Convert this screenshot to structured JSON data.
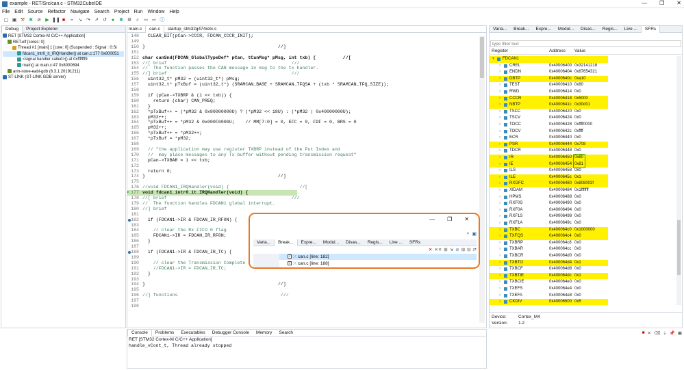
{
  "window": {
    "title": "example - RET/Src/can.c - STM32CubeIDE",
    "min": "—",
    "max": "❐",
    "close": "✕"
  },
  "menu": [
    "File",
    "Edit",
    "Source",
    "Refactor",
    "Navigate",
    "Search",
    "Project",
    "Run",
    "Window",
    "Help"
  ],
  "debug_panel": {
    "tabs": [
      "Debug",
      "Project Explorer"
    ],
    "tree": [
      {
        "t": "RET [STM32 Cortex-M C/C++ Application]",
        "indent": 0
      },
      {
        "t": "RET.elf [cores: 0]",
        "indent": 1
      },
      {
        "t": "Thread #1 [main] 1 [core: 0] (Suspended : Signal : 0:Si",
        "indent": 2
      },
      {
        "t": "fdcan1_intr0_it_IRQHandler() at can.c:177 0x800051",
        "indent": 3,
        "sel": true
      },
      {
        "t": "<signal handler called>() at 0xfffffff9",
        "indent": 3
      },
      {
        "t": "main() at main.c:47 0x8000694",
        "indent": 3
      },
      {
        "t": "arm-none-eabi-gdb (8.3.1.20191211)",
        "indent": 1
      },
      {
        "t": "ST-LINK (ST-LINK GDB server)",
        "indent": 0
      }
    ]
  },
  "editor": {
    "tabs": [
      "main.c",
      "can.c",
      "startup_stm32g474retx.s"
    ],
    "lines": [
      {
        "n": "148",
        "t": "  CLEAR_BIT(pCan->CCCR, FDCAN_CCCR_INIT);"
      },
      {
        "n": "149",
        "t": ""
      },
      {
        "n": "150",
        "t": "}                                                 //]"
      },
      {
        "n": "151",
        "t": ""
      },
      {
        "n": "152",
        "t": "char canSnd(FDCAN_GlobalTypeDef* pCan, tCanMsg* pMsg, int txb) {          //["
      },
      {
        "n": "153",
        "t": "//[ brief                                              ///"
      },
      {
        "n": "154",
        "t": "//  The function passes the CAN message in msg to the tx handler."
      },
      {
        "n": "155",
        "t": "//] brief                                              ///"
      },
      {
        "n": "156",
        "t": "  uint32_t* pM32 = (uint32_t*) pMsg;"
      },
      {
        "n": "157",
        "t": "  uint32_t* pTxBuf = (uint32_t*) (SRAMCAN_BASE + SRAMCAN_TFQSA + (txb * SRAMCAN_TFQ_SIZE));"
      },
      {
        "n": "158",
        "t": ""
      },
      {
        "n": "159",
        "t": "  if (pCan->TXBRP & (1 << txb)) {"
      },
      {
        "n": "160",
        "t": "    return (char) CAN_PREQ;"
      },
      {
        "n": "161",
        "t": "  }"
      },
      {
        "n": "162",
        "t": "  *pTxBuf++ = (*pM32 & 0x80000000U) ? (*pM32 << 18U) : (*pM32 | 0x40000000U);"
      },
      {
        "n": "163",
        "t": "  pM32++;"
      },
      {
        "n": "164",
        "t": "  *pTxBuf++ = *pM32 & 0x000F0000U;    // MM[7:0] = 0, EFC = 0, FDF = 0, BRS = 0"
      },
      {
        "n": "165",
        "t": "  pM32++;"
      },
      {
        "n": "166",
        "t": "  *pTxBuf++ = *pM32++;"
      },
      {
        "n": "167",
        "t": "  *pTxBuf = *pM32;"
      },
      {
        "n": "168",
        "t": ""
      },
      {
        "n": "169",
        "t": "  // \"the application may use register TXBRP instead of the Put Index and"
      },
      {
        "n": "170",
        "t": "  //  may place messages to any Tx buffer without pending transmission request\""
      },
      {
        "n": "171",
        "t": "  pCan->TXBAR = 1 << txb;"
      },
      {
        "n": "172",
        "t": ""
      },
      {
        "n": "173",
        "t": "  return 0;"
      },
      {
        "n": "174",
        "t": "}                                                 //]"
      },
      {
        "n": "175",
        "t": ""
      },
      {
        "n": "176",
        "t": "//void FDCAN1_IRQHandler(void) {                          //["
      },
      {
        "n": "177",
        "t": "void fdcan1_intr0_it_IRQHandler(void) {",
        "hl": true
      },
      {
        "n": "178",
        "t": "//[ brief                                              ///"
      },
      {
        "n": "179",
        "t": "//  The function handles FDCAN1 global interrupt."
      },
      {
        "n": "180",
        "t": "//] brief"
      },
      {
        "n": "181",
        "t": ""
      },
      {
        "n": "182",
        "t": "  if (FDCAN1->IR & FDCAN_IR_RF0N) {"
      },
      {
        "n": "183",
        "t": ""
      },
      {
        "n": "184",
        "t": "    // clear the Rx FIFO 0 flag"
      },
      {
        "n": "185",
        "t": "    FDCAN1->IR = FDCAN_IR_RF0N;"
      },
      {
        "n": "186",
        "t": "  }"
      },
      {
        "n": "187",
        "t": ""
      },
      {
        "n": "188",
        "t": "  if (FDCAN1->IR & FDCAN_IR_TC) {"
      },
      {
        "n": "189",
        "t": ""
      },
      {
        "n": "190",
        "t": "    // clear the Transmission Complete flag */"
      },
      {
        "n": "191",
        "t": "    //FDCAN1->IR = FDCAN_IR_TC;"
      },
      {
        "n": "192",
        "t": "  }"
      },
      {
        "n": "193",
        "t": ""
      },
      {
        "n": "194",
        "t": "}                                                 //]"
      },
      {
        "n": "195",
        "t": ""
      },
      {
        "n": "196",
        "t": "//] functions                                      ///"
      },
      {
        "n": "197",
        "t": ""
      },
      {
        "n": "198",
        "t": ""
      }
    ]
  },
  "breakpoints_popup": {
    "tabs": [
      "Varia...",
      "Break...",
      "Expre...",
      "Modul...",
      "Disas...",
      "Regis...",
      "Live ...",
      "SFRs"
    ],
    "items": [
      "can.c [line: 182]",
      "can.c [line: 188]"
    ]
  },
  "console": {
    "tabs": [
      "Console",
      "Problems",
      "Executables",
      "Debugger Console",
      "Memory",
      "Search"
    ],
    "launch": "RET [STM32 Cortex-M C/C++ Application]",
    "output": "handle_vCont_t, Thread already stopped"
  },
  "sfr_panel": {
    "tabs": [
      "Varia...",
      "Break...",
      "Expre...",
      "Modul...",
      "Disas...",
      "Regis...",
      "Live ...",
      "SFRs"
    ],
    "filter_placeholder": "type filter text",
    "columns": [
      "Register",
      "Address",
      "Value"
    ],
    "rows": [
      {
        "r": "FDCAN1",
        "a": "",
        "v": "",
        "hl": true,
        "grp": true
      },
      {
        "r": "CREL",
        "a": "0x40006400",
        "v": "0x32141218",
        "hl": false
      },
      {
        "r": "ENDN",
        "a": "0x40006404",
        "v": "0x87654321",
        "hl": false
      },
      {
        "r": "DBTP",
        "a": "0x4000640c",
        "v": "0xa10",
        "hl": true
      },
      {
        "r": "TEST",
        "a": "0x40006410",
        "v": "0x80",
        "hl": false
      },
      {
        "r": "RWD",
        "a": "0x40006414",
        "v": "0x0",
        "hl": false
      },
      {
        "r": "CCCR",
        "a": "0x40006418",
        "v": "0x5000",
        "hl": true
      },
      {
        "r": "NBTP",
        "a": "0x4000641c",
        "v": "0x30d01",
        "hl": true
      },
      {
        "r": "TSCC",
        "a": "0x40006420",
        "v": "0x0",
        "hl": false
      },
      {
        "r": "TSCV",
        "a": "0x40006424",
        "v": "0x0",
        "hl": false
      },
      {
        "r": "TOCC",
        "a": "0x40006428",
        "v": "0xffff0000",
        "hl": false
      },
      {
        "r": "TOCV",
        "a": "0x4000642c",
        "v": "0xffff",
        "hl": false
      },
      {
        "r": "ECR",
        "a": "0x40006440",
        "v": "0x0",
        "hl": false
      },
      {
        "r": "PSR",
        "a": "0x40006444",
        "v": "0x708",
        "hl": true
      },
      {
        "r": "TDCR",
        "a": "0x40006448",
        "v": "0x0",
        "hl": false
      },
      {
        "r": "IR",
        "a": "0x40006450",
        "v": "0x80",
        "hl": true,
        "box": true
      },
      {
        "r": "IE",
        "a": "0x40006454",
        "v": "0x81",
        "hl": true,
        "box": true
      },
      {
        "r": "ILS",
        "a": "0x40006458",
        "v": "0x0",
        "hl": false
      },
      {
        "r": "ILE",
        "a": "0x4000645c",
        "v": "0x1",
        "hl": true
      },
      {
        "r": "RXGFC",
        "a": "0x40006480",
        "v": "0x808003f",
        "hl": true
      },
      {
        "r": "XIDAM",
        "a": "0x40006484",
        "v": "0x1fffffff",
        "hl": false
      },
      {
        "r": "HPMS",
        "a": "0x40006488",
        "v": "0x0",
        "hl": false
      },
      {
        "r": "RXF0S",
        "a": "0x40006490",
        "v": "0x0",
        "hl": false
      },
      {
        "r": "RXF0A",
        "a": "0x40006494",
        "v": "0x0",
        "hl": false
      },
      {
        "r": "RXF1S",
        "a": "0x40006498",
        "v": "0x0",
        "hl": false
      },
      {
        "r": "RXF1A",
        "a": "0x4000649c",
        "v": "0x0",
        "hl": false
      },
      {
        "r": "TXBC",
        "a": "0x400064c0",
        "v": "0x1000000",
        "hl": true
      },
      {
        "r": "TXFQS",
        "a": "0x400064c4",
        "v": "0x0",
        "hl": true
      },
      {
        "r": "TXBRP",
        "a": "0x400064c8",
        "v": "0x0",
        "hl": false
      },
      {
        "r": "TXBAR",
        "a": "0x400064cc",
        "v": "0x0",
        "hl": false
      },
      {
        "r": "TXBCR",
        "a": "0x400064d0",
        "v": "0x0",
        "hl": false
      },
      {
        "r": "TXBTO",
        "a": "0x400064d4",
        "v": "0x1",
        "hl": true
      },
      {
        "r": "TXBCF",
        "a": "0x400064d8",
        "v": "0x0",
        "hl": false
      },
      {
        "r": "TXBTIE",
        "a": "0x400064dc",
        "v": "0x1",
        "hl": true
      },
      {
        "r": "TXBCIE",
        "a": "0x400064e0",
        "v": "0x0",
        "hl": false
      },
      {
        "r": "TXEFS",
        "a": "0x400064e4",
        "v": "0x0",
        "hl": false
      },
      {
        "r": "TXEFA",
        "a": "0x400064e8",
        "v": "0x0",
        "hl": false
      },
      {
        "r": "CKDIV",
        "a": "0x40006500",
        "v": "0x5",
        "hl": true
      }
    ],
    "device_label": "Device:",
    "device": "Cortex_M4",
    "version_label": "Version:",
    "version": "1.2"
  },
  "colors": {
    "highlight": "#fff100",
    "popup_border": "#e87722",
    "box": "#22aa22",
    "selection": "#cde8ff",
    "current_line": "#c8e6b4"
  }
}
